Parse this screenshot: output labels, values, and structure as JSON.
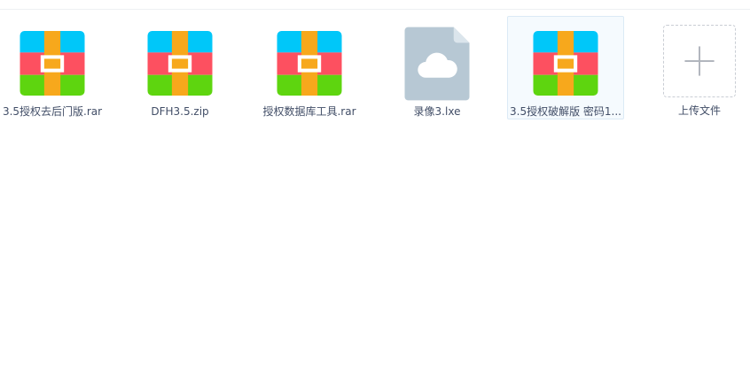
{
  "files": [
    {
      "name": "3.5授权去后门版.rar",
      "icon": "rar-archive-icon"
    },
    {
      "name": "DFH3.5.zip",
      "icon": "zip-archive-icon"
    },
    {
      "name": "授权数据库工具.rar",
      "icon": "rar-archive-icon"
    },
    {
      "name": "录像3.lxe",
      "icon": "cloud-file-icon"
    },
    {
      "name": "3.5授权破解版 密码1...",
      "icon": "rar-archive-icon",
      "selected": true
    }
  ],
  "upload": {
    "label": "上传文件",
    "icon": "plus-icon"
  },
  "colors": {
    "archive_blue": "#00c7f9",
    "archive_red": "#fd5060",
    "archive_green": "#5ed50f",
    "archive_strap": "#f7a81c",
    "cloud_file_bg": "#b7c8d4",
    "text": "#424e67"
  }
}
